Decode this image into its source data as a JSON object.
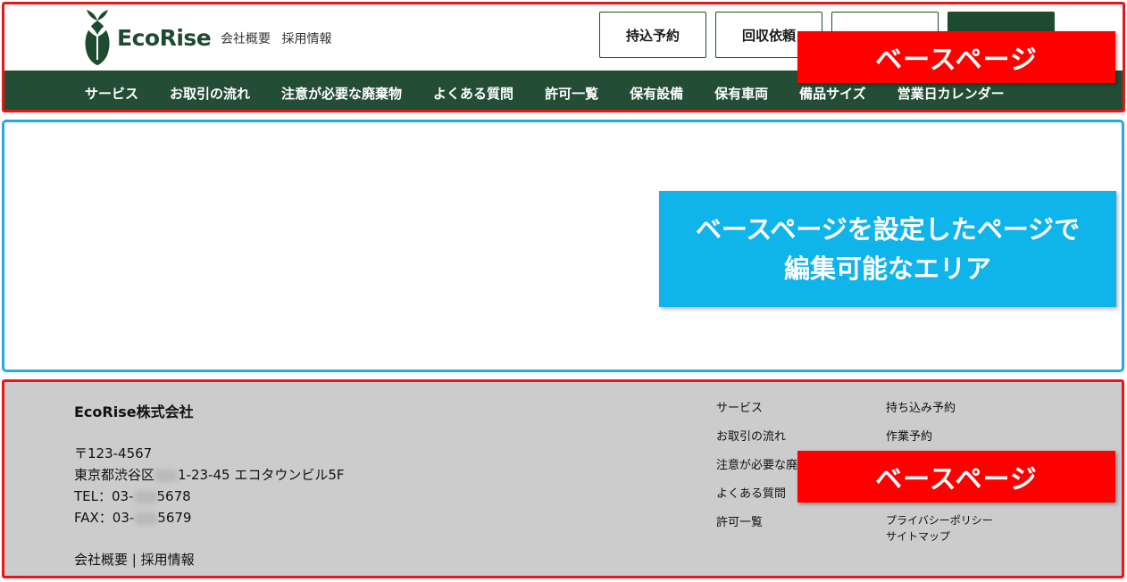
{
  "header": {
    "logo_text": "EcoRise",
    "top_links": [
      "会社概要",
      "採用情報"
    ],
    "buttons": [
      "持込予約",
      "回収依頼",
      "",
      ""
    ],
    "nav": [
      "サービス",
      "お取引の流れ",
      "注意が必要な廃棄物",
      "よくある質問",
      "許可一覧",
      "保有設備",
      "保有車両",
      "備品サイズ",
      "営業日カレンダー"
    ],
    "overlay_label": "ベースページ"
  },
  "main": {
    "overlay_line1": "ベースページを設定したページで",
    "overlay_line2": "編集可能なエリア"
  },
  "footer": {
    "company": "EcoRise株式会社",
    "postal": "〒123-4567",
    "addr_pre": "東京都渋谷区",
    "addr_post": "1-23-45 エコタウンビル5F",
    "tel_pre": "TEL：03-",
    "tel_post": "5678",
    "fax_pre": "FAX：03-",
    "fax_post": "5679",
    "bottom_links": "会社概要 | 採用情報",
    "col1": [
      "サービス",
      "お取引の流れ",
      "注意が必要な廃",
      "よくある質問",
      "許可一覧"
    ],
    "col2": [
      "持ち込み予約",
      "作業予約"
    ],
    "col2b": [
      "プライバシーポリシー",
      "サイトマップ"
    ],
    "overlay_label": "ベースページ"
  },
  "colors": {
    "brand_green": "#1e4b30",
    "nav_green": "#234d35",
    "red": "#ff0000",
    "blue": "#0fb4ea"
  }
}
